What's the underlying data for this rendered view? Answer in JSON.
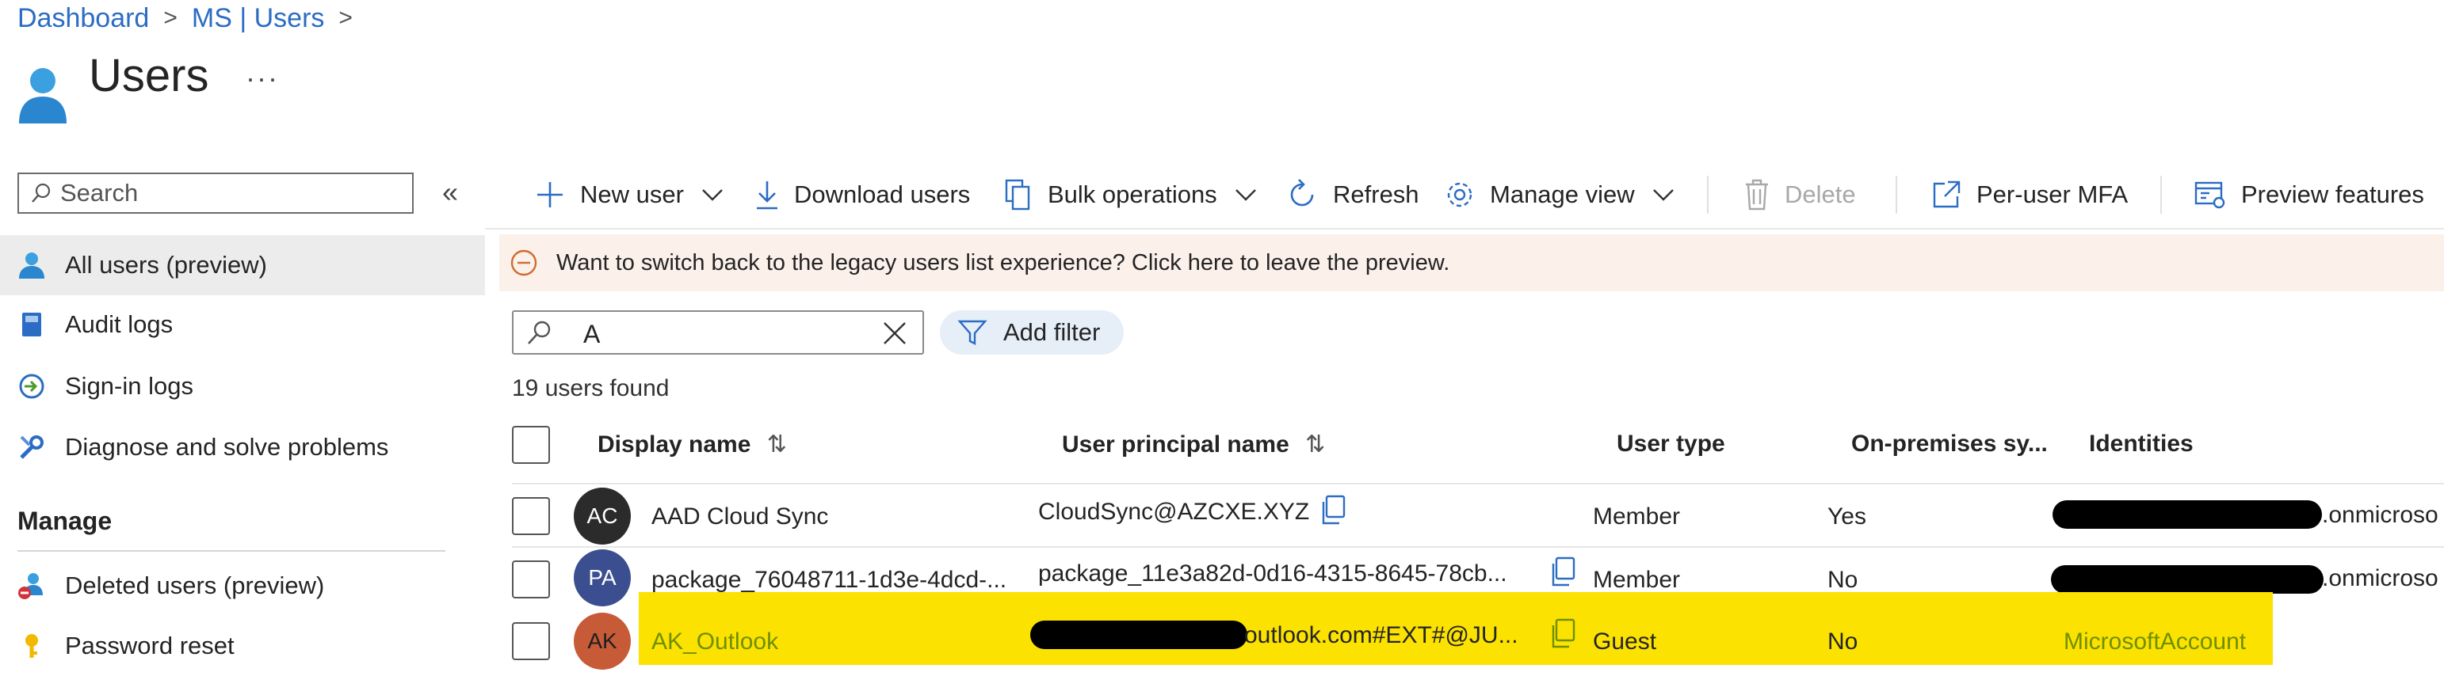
{
  "breadcrumb": {
    "items": [
      "Dashboard",
      "MS | Users"
    ]
  },
  "page": {
    "title": "Users",
    "more": "···"
  },
  "sidebar": {
    "search_placeholder": "Search",
    "collapse": "«",
    "items": [
      {
        "label": "All users (preview)",
        "icon": "user-icon",
        "selected": true
      },
      {
        "label": "Audit logs",
        "icon": "book-icon"
      },
      {
        "label": "Sign-in logs",
        "icon": "sign-in-icon"
      },
      {
        "label": "Diagnose and solve problems",
        "icon": "wrench-icon"
      }
    ],
    "manage_header": "Manage",
    "manage_items": [
      {
        "label": "Deleted users (preview)",
        "icon": "deleted-user-icon"
      },
      {
        "label": "Password reset",
        "icon": "key-icon"
      }
    ]
  },
  "toolbar": {
    "new_user": "New user",
    "download_users": "Download users",
    "bulk_operations": "Bulk operations",
    "refresh": "Refresh",
    "manage_view": "Manage view",
    "delete": "Delete",
    "per_user_mfa": "Per-user MFA",
    "preview_features": "Preview features"
  },
  "banner": {
    "text": "Want to switch back to the legacy users list experience? Click here to leave the preview."
  },
  "filter": {
    "value": "A",
    "add_filter": "Add filter"
  },
  "results": {
    "count_text": "19 users found"
  },
  "table": {
    "headers": {
      "display_name": "Display name",
      "upn": "User principal name",
      "user_type": "User type",
      "on_prem": "On-premises sy...",
      "identities": "Identities"
    },
    "rows": [
      {
        "initials": "AC",
        "avatar_color": "#2b2b2b",
        "display_name": "AAD Cloud Sync",
        "upn": "CloudSync@AZCXE.XYZ",
        "user_type": "Member",
        "on_prem": "Yes",
        "identities": ".onmicroso"
      },
      {
        "initials": "PA",
        "avatar_color": "#3b4e8f",
        "display_name": "package_76048711-1d3e-4dcd-...",
        "upn": "package_11e3a82d-0d16-4315-8645-78cb...",
        "user_type": "Member",
        "on_prem": "No",
        "identities": ".onmicroso"
      },
      {
        "initials": "AK",
        "avatar_color": "#c75b38",
        "display_name": "AK_Outlook",
        "upn": "outlook.com#EXT#@JU...",
        "user_type": "Guest",
        "on_prem": "No",
        "identities": "MicrosoftAccount"
      }
    ]
  },
  "colors": {
    "link": "#2b6cc4",
    "highlight": "#fce200",
    "banner_bg": "#fbf1ea"
  }
}
